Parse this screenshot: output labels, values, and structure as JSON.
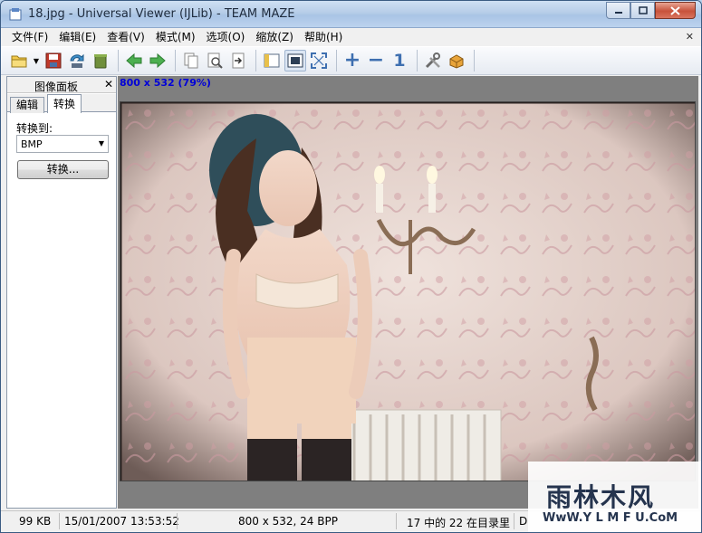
{
  "window": {
    "title": "18.jpg - Universal Viewer (IJLib) - TEAM MAZE"
  },
  "menu": [
    "文件(F)",
    "编辑(E)",
    "查看(V)",
    "模式(M)",
    "选项(O)",
    "缩放(Z)",
    "帮助(H)"
  ],
  "toolbar": {
    "buttons": [
      "open-icon",
      "save-icon",
      "save-as-icon",
      "recycle-icon",
      "back-icon",
      "forward-icon",
      "copy-icon",
      "preview-icon",
      "export-icon",
      "panel-icon",
      "fit-window-icon",
      "fullscreen-icon",
      "zoom-in-icon",
      "zoom-out-icon",
      "actual-size-icon",
      "tools-icon",
      "plugin-icon"
    ],
    "zoom_in_label": "+",
    "zoom_out_label": "−",
    "actual_size_label": "1"
  },
  "panel": {
    "title": "图像面板",
    "tabs": [
      "编辑",
      "转换"
    ],
    "active_tab": "转换",
    "convert_to_label": "转换到:",
    "format_value": "BMP",
    "convert_button": "转换..."
  },
  "viewer": {
    "info": "800 x 532 (79%)"
  },
  "status": {
    "size": "99 KB",
    "date": "15/01/2007 13:53:52",
    "dimensions": "800 x 532, 24 BPP",
    "position": "17 中的 22 在目录里",
    "extra": "D"
  },
  "watermark": {
    "text": "雨林木风",
    "url": "WwW.Y L M F U.CoM"
  },
  "colors": {
    "info_text": "#0000d8",
    "titlebar": "#b6cde8",
    "viewer_bg": "#7f7f7f"
  }
}
